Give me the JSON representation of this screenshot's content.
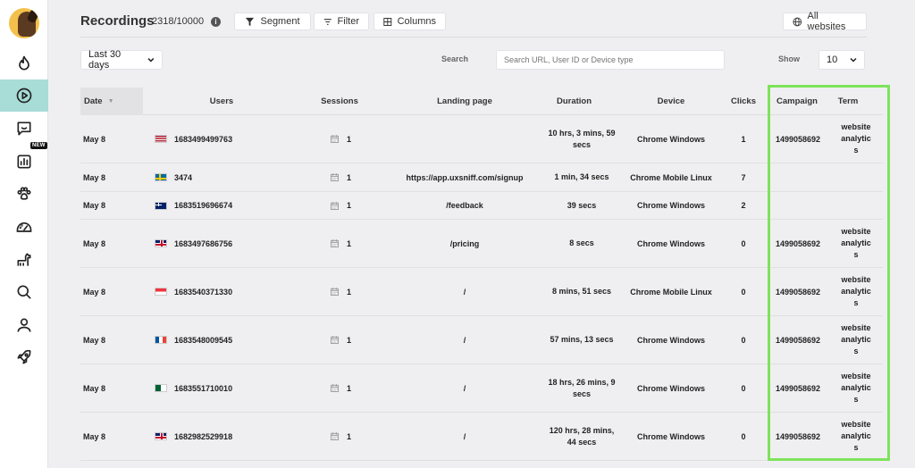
{
  "header": {
    "title": "Recordings",
    "count": "2318/10000",
    "info": "i",
    "segment_label": "Segment",
    "filter_label": "Filter",
    "columns_label": "Columns",
    "all_websites_label": "All websites"
  },
  "filters": {
    "date_range": "Last 30 days",
    "search_label": "Search",
    "search_placeholder": "Search URL, User ID or Device type",
    "show_label": "Show",
    "show_value": "10"
  },
  "sidebar": {
    "new_badge": "NEW",
    "items": [
      "flame-icon",
      "play-icon",
      "chat-icon",
      "chart-icon",
      "paw-icon",
      "dashboard-icon",
      "dog-icon",
      "search-icon",
      "user-icon",
      "rocket-icon"
    ]
  },
  "table": {
    "columns": {
      "date": "Date",
      "users": "Users",
      "sessions": "Sessions",
      "landing": "Landing page",
      "duration": "Duration",
      "device": "Device",
      "clicks": "Clicks",
      "campaign": "Campaign",
      "term": "Term"
    },
    "rows": [
      {
        "date": "May 8",
        "flag": "us",
        "user": "1683499499763",
        "sessions": "1",
        "landing": "",
        "duration": "10 hrs, 3 mins, 59 secs",
        "device": "Chrome Windows",
        "clicks": "1",
        "campaign": "1499058692",
        "term": "website analytic s"
      },
      {
        "date": "May 8",
        "flag": "se",
        "user": "3474",
        "sessions": "1",
        "landing": "https://app.uxsniff.com/signup",
        "duration": "1 min, 34 secs",
        "device": "Chrome Mobile Linux",
        "clicks": "7",
        "campaign": "",
        "term": ""
      },
      {
        "date": "May 8",
        "flag": "au",
        "user": "1683519696674",
        "sessions": "1",
        "landing": "/feedback",
        "duration": "39 secs",
        "device": "Chrome Windows",
        "clicks": "2",
        "campaign": "",
        "term": ""
      },
      {
        "date": "May 8",
        "flag": "gb",
        "user": "1683497686756",
        "sessions": "1",
        "landing": "/pricing",
        "duration": "8 secs",
        "device": "Chrome Windows",
        "clicks": "0",
        "campaign": "1499058692",
        "term": "website analytic s"
      },
      {
        "date": "May 8",
        "flag": "sg",
        "user": "1683540371330",
        "sessions": "1",
        "landing": "/",
        "duration": "8 mins, 51 secs",
        "device": "Chrome Mobile Linux",
        "clicks": "0",
        "campaign": "1499058692",
        "term": "website analytic s"
      },
      {
        "date": "May 8",
        "flag": "fr",
        "user": "1683548009545",
        "sessions": "1",
        "landing": "/",
        "duration": "57 mins, 13 secs",
        "device": "Chrome Windows",
        "clicks": "0",
        "campaign": "1499058692",
        "term": "website analytic s"
      },
      {
        "date": "May 8",
        "flag": "dz",
        "user": "1683551710010",
        "sessions": "1",
        "landing": "/",
        "duration": "18 hrs, 26 mins, 9 secs",
        "device": "Chrome Windows",
        "clicks": "0",
        "campaign": "1499058692",
        "term": "website analytic s"
      },
      {
        "date": "May 8",
        "flag": "gb",
        "user": "1682982529918",
        "sessions": "1",
        "landing": "/",
        "duration": "120 hrs, 28 mins, 44 secs",
        "device": "Chrome Windows",
        "clicks": "0",
        "campaign": "1499058692",
        "term": "website analytic s"
      }
    ]
  },
  "colors": {
    "accent": "#a8dcd6",
    "highlight": "#7ee35a",
    "background": "#efeff1"
  }
}
